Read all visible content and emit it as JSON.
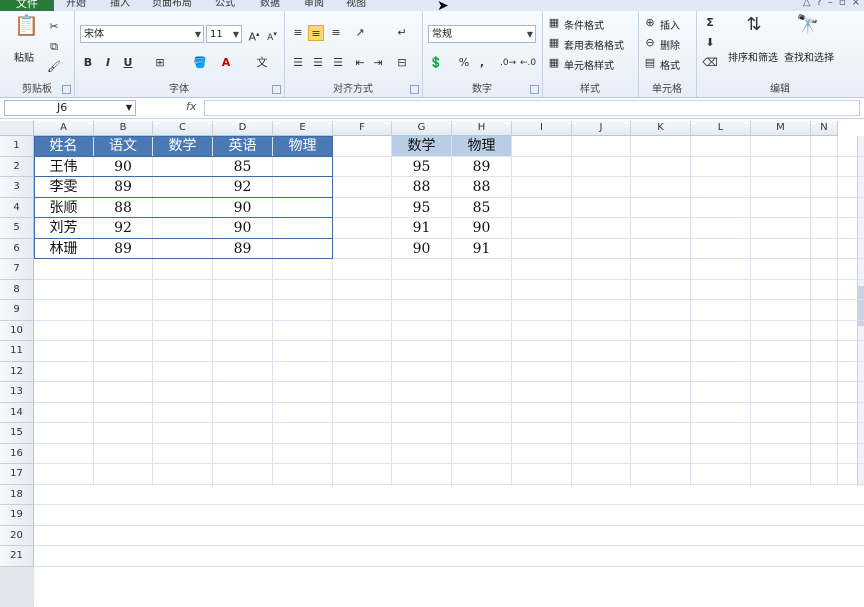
{
  "ribbon_tabs": [
    "文件",
    "开始",
    "插入",
    "页面布局",
    "公式",
    "数据",
    "审阅",
    "视图"
  ],
  "groups": {
    "clipboard": {
      "label": "剪贴板",
      "paste": "粘贴"
    },
    "font": {
      "label": "字体",
      "font_name": "宋体",
      "font_size": "11",
      "bold": "B",
      "italic": "I",
      "underline": "U"
    },
    "alignment": {
      "label": "对齐方式"
    },
    "number": {
      "label": "数字",
      "format": "常规",
      "percent": "%",
      "comma": ","
    },
    "styles": {
      "label": "样式",
      "cond_format": "条件格式",
      "table_format": "套用表格格式",
      "cell_style": "单元格样式"
    },
    "cells": {
      "label": "单元格",
      "insert": "插入",
      "delete": "删除",
      "format": "格式"
    },
    "editing": {
      "label": "编辑",
      "sort_filter": "排序和筛选",
      "find_select": "查找和选择",
      "sigma": "Σ"
    }
  },
  "formula_bar": {
    "name_box": "J6",
    "fx": "fx",
    "formula": ""
  },
  "columns": [
    "A",
    "B",
    "C",
    "D",
    "E",
    "F",
    "G",
    "H",
    "I",
    "J",
    "K",
    "L",
    "M",
    "N"
  ],
  "rows": [
    "1",
    "2",
    "3",
    "4",
    "5",
    "6",
    "7",
    "8",
    "9",
    "10",
    "11",
    "12",
    "13",
    "14",
    "15",
    "16",
    "17",
    "18",
    "19",
    "20",
    "21"
  ],
  "table1": {
    "headers": [
      "姓名",
      "语文",
      "数学",
      "英语",
      "物理"
    ],
    "rows": [
      [
        "王伟",
        "90",
        "",
        "85",
        ""
      ],
      [
        "李雯",
        "89",
        "",
        "92",
        ""
      ],
      [
        "张顺",
        "88",
        "",
        "90",
        ""
      ],
      [
        "刘芳",
        "92",
        "",
        "90",
        ""
      ],
      [
        "林珊",
        "89",
        "",
        "89",
        ""
      ]
    ]
  },
  "table2": {
    "headers": [
      "数学",
      "物理"
    ],
    "rows": [
      [
        "95",
        "89"
      ],
      [
        "88",
        "88"
      ],
      [
        "95",
        "85"
      ],
      [
        "91",
        "90"
      ],
      [
        "90",
        "91"
      ]
    ]
  }
}
